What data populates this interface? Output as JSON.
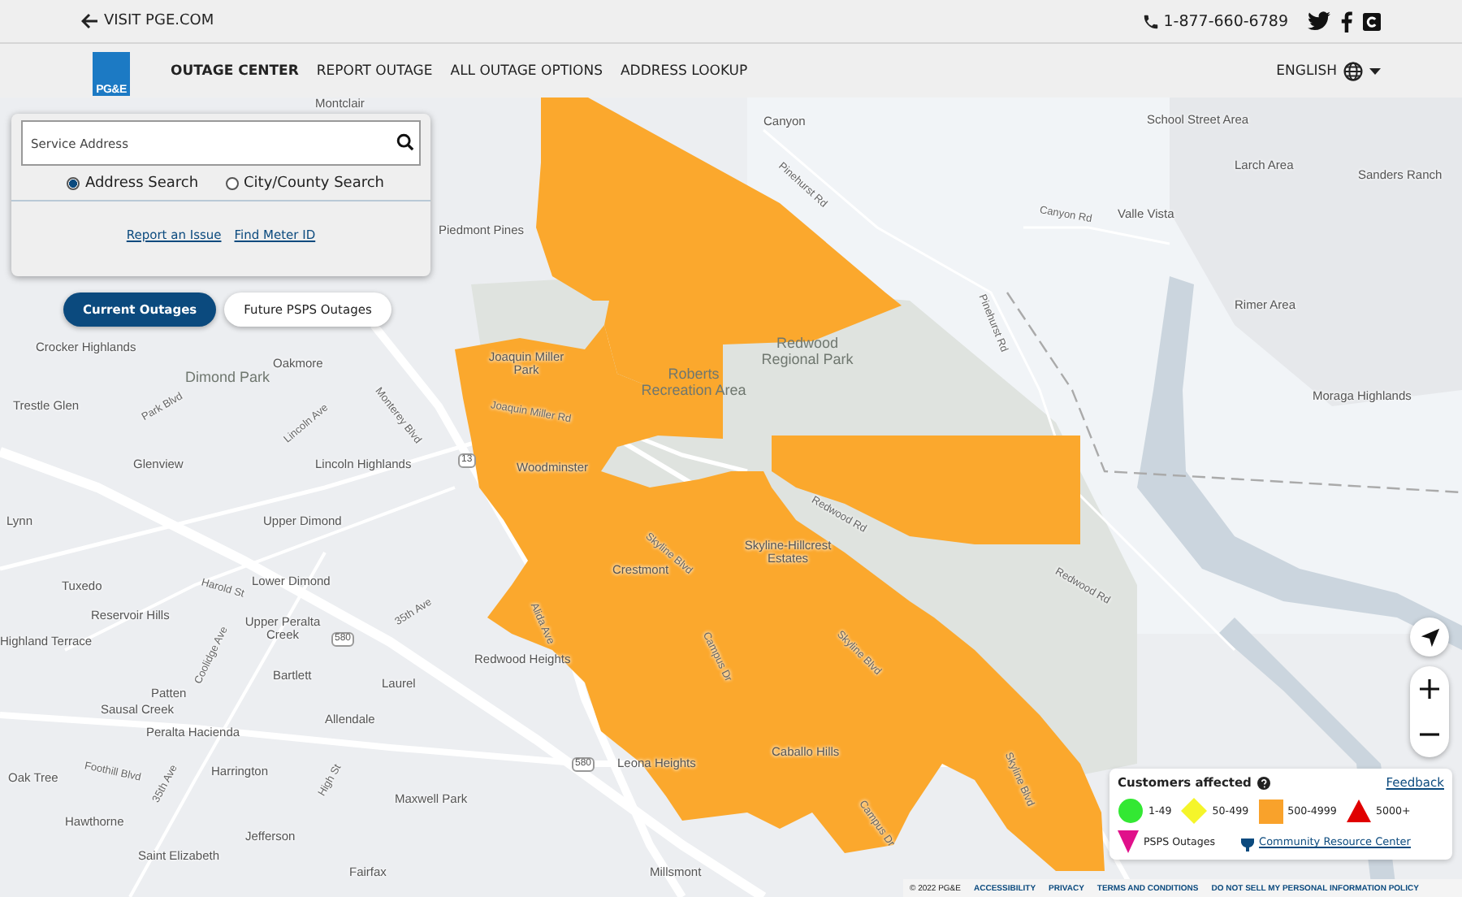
{
  "top_bar": {
    "back_link": "VISIT PGE.COM",
    "phone": "1-877-660-6789"
  },
  "nav": {
    "logo": "PG&E",
    "items": [
      {
        "label": "OUTAGE CENTER",
        "selected": true
      },
      {
        "label": "REPORT OUTAGE",
        "selected": false
      },
      {
        "label": "ALL OUTAGE OPTIONS",
        "selected": false
      },
      {
        "label": "ADDRESS LOOKUP",
        "selected": false
      }
    ],
    "language": "ENGLISH"
  },
  "search": {
    "placeholder": "Service Address",
    "options": [
      {
        "label": "Address Search",
        "selected": true
      },
      {
        "label": "City/County Search",
        "selected": false
      }
    ],
    "links": [
      "Report an Issue",
      "Find Meter ID"
    ]
  },
  "outage_tabs": [
    {
      "label": "Current Outages",
      "selected": true
    },
    {
      "label": "Future PSPS Outages",
      "selected": false
    }
  ],
  "map_labels": [
    {
      "text": "Montclair",
      "kind": "place"
    },
    {
      "text": "Canyon",
      "kind": "place"
    },
    {
      "text": "School Street Area",
      "kind": "place"
    },
    {
      "text": "Larch Area",
      "kind": "place"
    },
    {
      "text": "Sanders Ranch",
      "kind": "place"
    },
    {
      "text": "Pinehurst Rd",
      "kind": "road"
    },
    {
      "text": "Canyon Rd",
      "kind": "road"
    },
    {
      "text": "Valle Vista",
      "kind": "place"
    },
    {
      "text": "Pinehurst Rd",
      "kind": "road"
    },
    {
      "text": "Rimer Area",
      "kind": "place"
    },
    {
      "text": "Piedmont Pines",
      "kind": "place"
    },
    {
      "text": "Redwood Regional Park",
      "kind": "park"
    },
    {
      "text": "Roberts Recreation Area",
      "kind": "park"
    },
    {
      "text": "Joaquin Miller Park",
      "kind": "place"
    },
    {
      "text": "Joaquin Miller Rd",
      "kind": "road"
    },
    {
      "text": "Moraga Highlands",
      "kind": "place"
    },
    {
      "text": "Crocker Highlands",
      "kind": "place"
    },
    {
      "text": "Oakmore",
      "kind": "place"
    },
    {
      "text": "Dimond Park",
      "kind": "park"
    },
    {
      "text": "Trestle Glen",
      "kind": "place"
    },
    {
      "text": "Park Blvd",
      "kind": "road"
    },
    {
      "text": "Monterey Blvd",
      "kind": "road"
    },
    {
      "text": "Lincoln Ave",
      "kind": "road"
    },
    {
      "text": "Glenview",
      "kind": "place"
    },
    {
      "text": "Lincoln Highlands",
      "kind": "place"
    },
    {
      "text": "Woodminster",
      "kind": "place"
    },
    {
      "text": "Lynn",
      "kind": "place"
    },
    {
      "text": "Upper Dimond",
      "kind": "place"
    },
    {
      "text": "Harold St",
      "kind": "road"
    },
    {
      "text": "Lower Dimond",
      "kind": "place"
    },
    {
      "text": "Tuxedo",
      "kind": "place"
    },
    {
      "text": "Crestmont",
      "kind": "place"
    },
    {
      "text": "Skyline-Hillcrest Estates",
      "kind": "place"
    },
    {
      "text": "Skyline Blvd",
      "kind": "road"
    },
    {
      "text": "Reservoir Hills",
      "kind": "place"
    },
    {
      "text": "Upper Peralta Creek",
      "kind": "place"
    },
    {
      "text": "Highland Terrace",
      "kind": "place"
    },
    {
      "text": "Bartlett",
      "kind": "place"
    },
    {
      "text": "Laurel",
      "kind": "place"
    },
    {
      "text": "Redwood Heights",
      "kind": "place"
    },
    {
      "text": "Patten",
      "kind": "place"
    },
    {
      "text": "Sausal Creek",
      "kind": "place"
    },
    {
      "text": "Allendale",
      "kind": "place"
    },
    {
      "text": "Peralta Hacienda",
      "kind": "place"
    },
    {
      "text": "Harrington",
      "kind": "place"
    },
    {
      "text": "Maxwell Park",
      "kind": "place"
    },
    {
      "text": "Oak Tree",
      "kind": "place"
    },
    {
      "text": "Hawthorne",
      "kind": "place"
    },
    {
      "text": "Jefferson",
      "kind": "place"
    },
    {
      "text": "Saint Elizabeth",
      "kind": "place"
    },
    {
      "text": "Fairfax",
      "kind": "place"
    },
    {
      "text": "Leona Heights",
      "kind": "place"
    },
    {
      "text": "Caballo Hills",
      "kind": "place"
    },
    {
      "text": "Millsmont",
      "kind": "place"
    },
    {
      "text": "Campus Dr",
      "kind": "road"
    },
    {
      "text": "Skyline Blvd",
      "kind": "road"
    },
    {
      "text": "Redwood Rd",
      "kind": "road"
    },
    {
      "text": "35th Ave",
      "kind": "road"
    },
    {
      "text": "Foothill Blvd",
      "kind": "road"
    },
    {
      "text": "Campus Dr",
      "kind": "road"
    },
    {
      "text": "Skyline Blvd",
      "kind": "road"
    },
    {
      "text": "Alida Ave",
      "kind": "road"
    },
    {
      "text": "Redwood Rd",
      "kind": "road"
    },
    {
      "text": "Coolidge Ave",
      "kind": "road"
    },
    {
      "text": "High St",
      "kind": "road"
    },
    {
      "text": "35th Ave",
      "kind": "road"
    },
    {
      "text": "13",
      "kind": "shield"
    },
    {
      "text": "580",
      "kind": "shield"
    },
    {
      "text": "580",
      "kind": "shield"
    }
  ],
  "legend": {
    "title": "Customers affected",
    "feedback": "Feedback",
    "items": [
      {
        "label": "1-49",
        "kind": "circle",
        "color": "#33e833"
      },
      {
        "label": "50-499",
        "kind": "diamond",
        "color": "#f5f52a"
      },
      {
        "label": "500-4999",
        "kind": "square",
        "color": "#f9a22b"
      },
      {
        "label": "5000+",
        "kind": "triangle",
        "color": "#e00000"
      },
      {
        "label": "PSPS Outages",
        "kind": "triangle-down",
        "color": "#e0108a"
      }
    ],
    "resource_link": "Community Resource Center"
  },
  "footer": {
    "copyright": "© 2022 PG&E",
    "links": [
      "ACCESSIBILITY",
      "PRIVACY",
      "TERMS AND CONDITIONS",
      "DO NOT SELL MY PERSONAL INFORMATION POLICY"
    ]
  }
}
